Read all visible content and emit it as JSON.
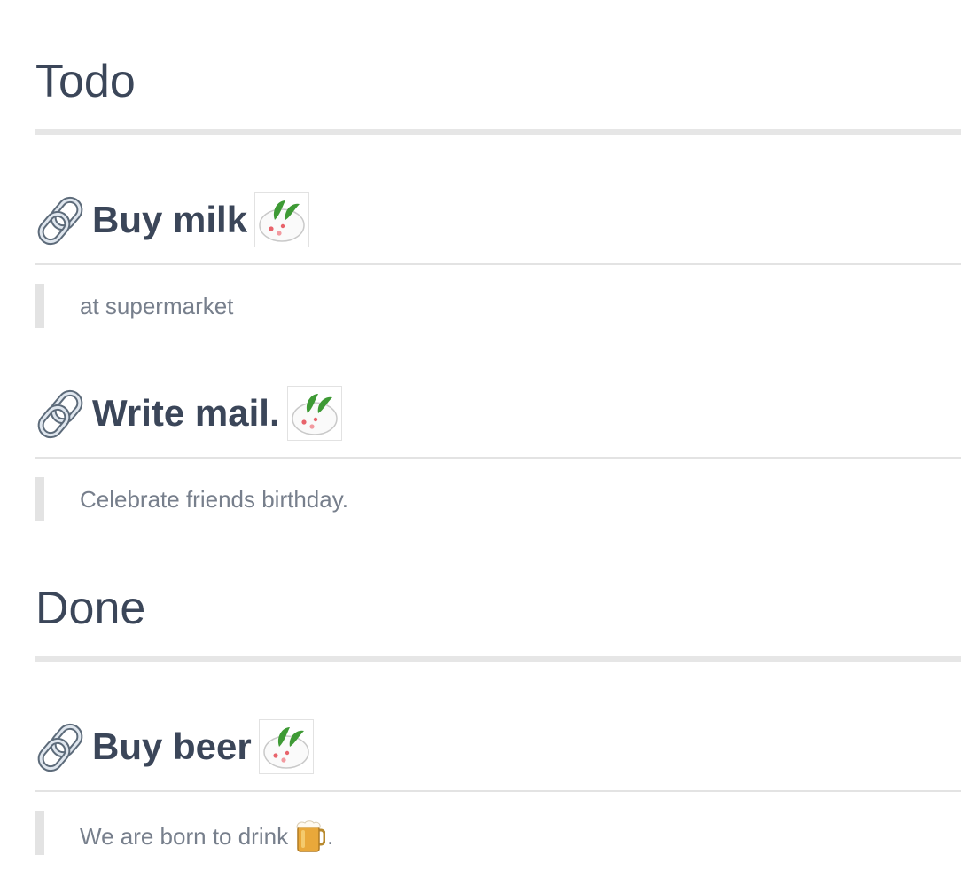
{
  "sections": [
    {
      "title": "Todo",
      "items": [
        {
          "title": "Buy milk",
          "note": "at supermarket"
        },
        {
          "title": "Write mail.",
          "note": "Celebrate friends birthday."
        }
      ]
    },
    {
      "title": "Done",
      "items": [
        {
          "title": "Buy beer",
          "note_prefix": "We are born to drink",
          "note_suffix": "."
        }
      ]
    }
  ],
  "icons": {
    "link": "link-icon",
    "mochi": "mochi-rabbit-icon",
    "beer": "beer-mug-icon"
  },
  "colors": {
    "heading": "#3b4659",
    "body_text": "#777f8c",
    "rule": "#e6e6e6"
  }
}
